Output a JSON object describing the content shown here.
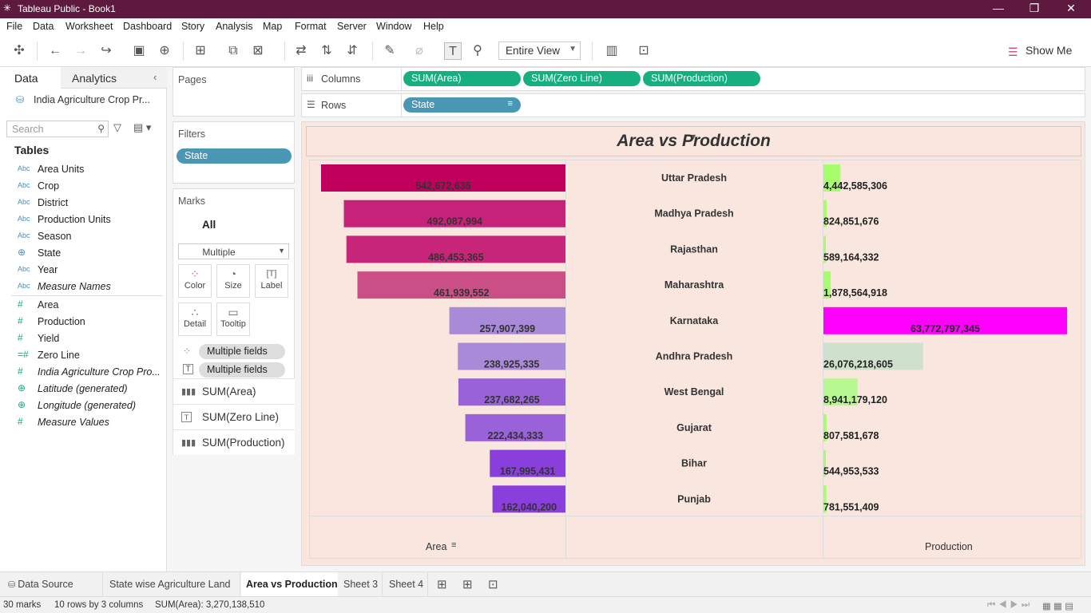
{
  "window": {
    "title": "Tableau Public - Book1"
  },
  "menu": [
    "File",
    "Data",
    "Worksheet",
    "Dashboard",
    "Story",
    "Analysis",
    "Map",
    "Format",
    "Server",
    "Window",
    "Help"
  ],
  "toolbar": {
    "fit_mode": "Entire View",
    "show_me": "Show Me"
  },
  "data_pane": {
    "tabs": [
      "Data",
      "Analytics"
    ],
    "datasource": "India Agriculture Crop Pr...",
    "search_placeholder": "Search",
    "tables_heading": "Tables",
    "dimensions": [
      {
        "type": "Abc",
        "name": "Area Units"
      },
      {
        "type": "Abc",
        "name": "Crop"
      },
      {
        "type": "Abc",
        "name": "District"
      },
      {
        "type": "Abc",
        "name": "Production Units"
      },
      {
        "type": "Abc",
        "name": "Season"
      },
      {
        "type": "globe",
        "name": "State"
      },
      {
        "type": "Abc",
        "name": "Year"
      },
      {
        "type": "Abc",
        "name": "Measure Names"
      }
    ],
    "measures": [
      {
        "type": "#",
        "name": "Area"
      },
      {
        "type": "#",
        "name": "Production"
      },
      {
        "type": "#",
        "name": "Yield"
      },
      {
        "type": "calc#",
        "name": "Zero Line"
      },
      {
        "type": "#",
        "name": "India Agriculture Crop Pro..."
      },
      {
        "type": "globe",
        "name": "Latitude (generated)"
      },
      {
        "type": "globe",
        "name": "Longitude (generated)"
      },
      {
        "type": "#",
        "name": "Measure Values"
      }
    ]
  },
  "pages": {
    "heading": "Pages"
  },
  "filters": {
    "heading": "Filters",
    "items": [
      "State"
    ]
  },
  "marks": {
    "heading": "Marks",
    "all_label": "All",
    "mark_type": "Multiple",
    "buttons": [
      "Color",
      "Size",
      "Label",
      "Detail",
      "Tooltip"
    ],
    "fields": [
      "Multiple fields",
      "Multiple fields"
    ],
    "cards": [
      "SUM(Area)",
      "SUM(Zero Line)",
      "SUM(Production)"
    ]
  },
  "shelves": {
    "columns_label": "Columns",
    "columns": [
      "SUM(Area)",
      "SUM(Zero Line)",
      "SUM(Production)"
    ],
    "rows_label": "Rows",
    "rows": [
      "State"
    ]
  },
  "chart_data": {
    "type": "bar",
    "title": "Area vs Production",
    "categories": [
      "Uttar Pradesh",
      "Madhya Pradesh",
      "Rajasthan",
      "Maharashtra",
      "Karnataka",
      "Andhra Pradesh",
      "West Bengal",
      "Gujarat",
      "Bihar",
      "Punjab"
    ],
    "series": [
      {
        "name": "Area",
        "values": [
          542672635,
          492087994,
          486453365,
          461939552,
          257907399,
          238925335,
          237682265,
          222434333,
          167995431,
          162040200
        ],
        "labels": [
          "542,672,635",
          "492,087,994",
          "486,453,365",
          "461,939,552",
          "257,907,399",
          "238,925,335",
          "237,682,265",
          "222,434,333",
          "167,995,431",
          "162,040,200"
        ],
        "colors": [
          "#c0005c",
          "#c6227a",
          "#c6257a",
          "#cb4f87",
          "#a98ad8",
          "#a98ad8",
          "#9a62d8",
          "#9a62d8",
          "#8a3edb",
          "#8a3edb"
        ]
      },
      {
        "name": "Production",
        "values": [
          4442585306,
          824851676,
          589164332,
          1878564918,
          63772797345,
          26076218605,
          8941179120,
          807581678,
          544953533,
          781551409
        ],
        "labels": [
          "4,442,585,306",
          "824,851,676",
          "589,164,332",
          "1,878,564,918",
          "63,772,797,345",
          "26,076,218,605",
          "8,941,179,120",
          "807,581,678",
          "544,953,533",
          "781,551,409"
        ],
        "colors": [
          "#a6ff6a",
          "#a6ff6a",
          "#a6ff6a",
          "#a6ff6a",
          "#ff00ff",
          "#cfe0cc",
          "#b8f890",
          "#a6ff6a",
          "#a6ff6a",
          "#a6ff6a"
        ]
      }
    ],
    "xlabel_left": "Area",
    "xlabel_right": "Production",
    "sort": "descending by Area"
  },
  "sheet_tabs": [
    "Data Source",
    "State wise Agriculture Land",
    "Area vs Production",
    "Sheet 3",
    "Sheet 4"
  ],
  "active_tab": "Area vs Production",
  "status": {
    "marks": "30 marks",
    "dims": "10 rows by 3 columns",
    "sum": "SUM(Area): 3,270,138,510"
  }
}
